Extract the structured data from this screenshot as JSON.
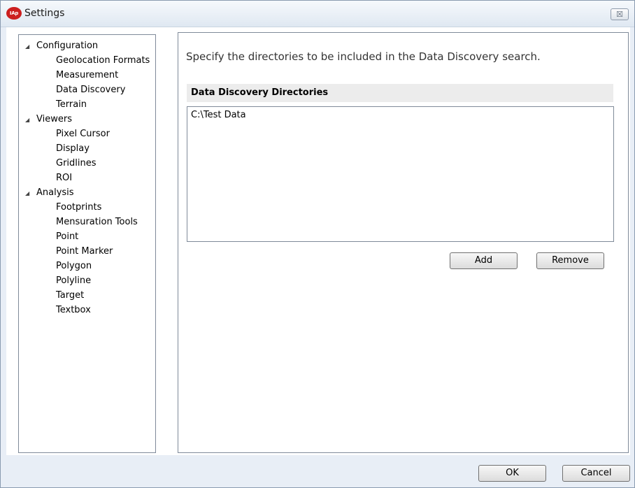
{
  "window": {
    "title": "Settings",
    "close_glyph": "☒",
    "app_icon_text": "IAp"
  },
  "tree": {
    "groups": [
      {
        "label": "Configuration",
        "children": [
          "Geolocation Formats",
          "Measurement",
          "Data Discovery",
          "Terrain"
        ]
      },
      {
        "label": "Viewers",
        "children": [
          "Pixel Cursor",
          "Display",
          "Gridlines",
          "ROI"
        ]
      },
      {
        "label": "Analysis",
        "children": [
          "Footprints",
          "Mensuration Tools",
          "Point",
          "Point Marker",
          "Polygon",
          "Polyline",
          "Target",
          "Textbox"
        ]
      }
    ],
    "selected": "Data Discovery"
  },
  "content": {
    "description": "Specify the directories to be included in the Data Discovery search.",
    "section_header": "Data Discovery Directories",
    "directories": [
      "C:\\Test Data"
    ],
    "add_label": "Add",
    "remove_label": "Remove"
  },
  "footer": {
    "ok_label": "OK",
    "cancel_label": "Cancel"
  }
}
